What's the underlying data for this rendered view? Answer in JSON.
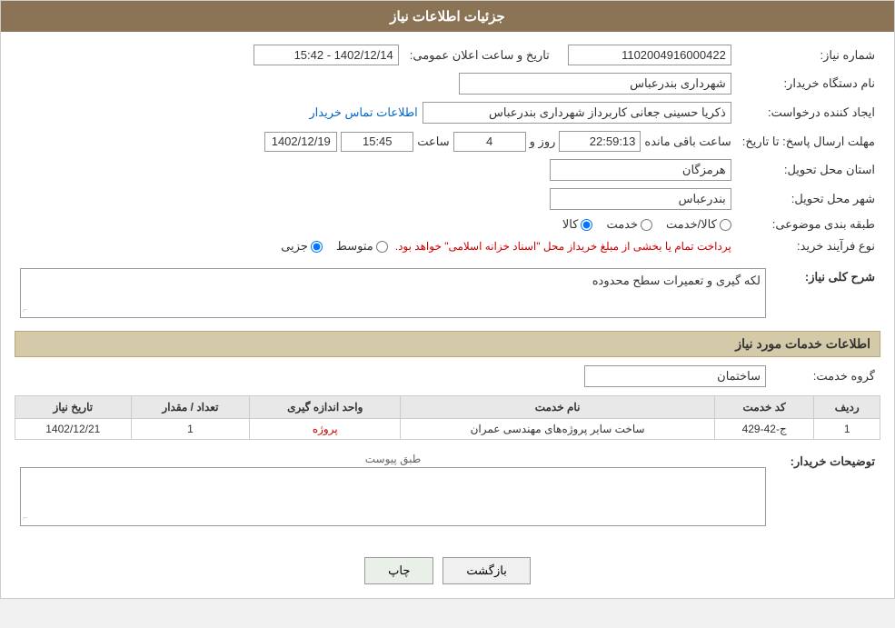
{
  "header": {
    "title": "جزئیات اطلاعات نیاز"
  },
  "fields": {
    "request_number_label": "شماره نیاز:",
    "request_number_value": "1102004916000422",
    "date_label": "تاریخ و ساعت اعلان عمومی:",
    "date_value": "1402/12/14 - 15:42",
    "org_name_label": "نام دستگاه خریدار:",
    "org_name_value": "شهرداری بندرعباس",
    "creator_label": "ایجاد کننده درخواست:",
    "creator_value": "ذکریا حسینی جعانی کاربرداز شهرداری بندرعباس",
    "contact_link": "اطلاعات تماس خریدار",
    "deadline_label": "مهلت ارسال پاسخ: تا تاریخ:",
    "deadline_date": "1402/12/19",
    "deadline_time_label": "ساعت",
    "deadline_time": "15:45",
    "deadline_days_label": "روز و",
    "deadline_days": "4",
    "deadline_remaining_label": "ساعت باقی مانده",
    "deadline_remaining": "22:59:13",
    "province_label": "استان محل تحویل:",
    "province_value": "هرمزگان",
    "city_label": "شهر محل تحویل:",
    "city_value": "بندرعباس",
    "category_label": "طبقه بندی موضوعی:",
    "category_radio1": "کالا",
    "category_radio2": "خدمت",
    "category_radio3": "کالا/خدمت",
    "purchase_type_label": "نوع فرآیند خرید:",
    "purchase_radio1": "جزیی",
    "purchase_radio2": "متوسط",
    "purchase_text": "پرداخت تمام یا بخشی از مبلغ خریداز محل \"اسناد خزانه اسلامی\" خواهد بود."
  },
  "description": {
    "section_title": "شرح کلی نیاز:",
    "value": "لکه گیری و تعمیرات سطح محدوده"
  },
  "services_section": {
    "title": "اطلاعات خدمات مورد نیاز",
    "service_group_label": "گروه خدمت:",
    "service_group_value": "ساختمان",
    "table_headers": {
      "row_num": "ردیف",
      "service_code": "کد خدمت",
      "service_name": "نام خدمت",
      "unit": "واحد اندازه گیری",
      "quantity": "تعداد / مقدار",
      "date": "تاریخ نیاز"
    },
    "rows": [
      {
        "row_num": "1",
        "service_code": "ج-42-429",
        "service_name": "ساخت سایر پروژه‌های مهندسی عمران",
        "unit": "پروژه",
        "quantity": "1",
        "date": "1402/12/21"
      }
    ]
  },
  "buyer_notes": {
    "label": "توضیحات خریدار:",
    "attachment_label": "طبق پیوست",
    "value": ""
  },
  "buttons": {
    "print": "چاپ",
    "back": "بازگشت"
  }
}
